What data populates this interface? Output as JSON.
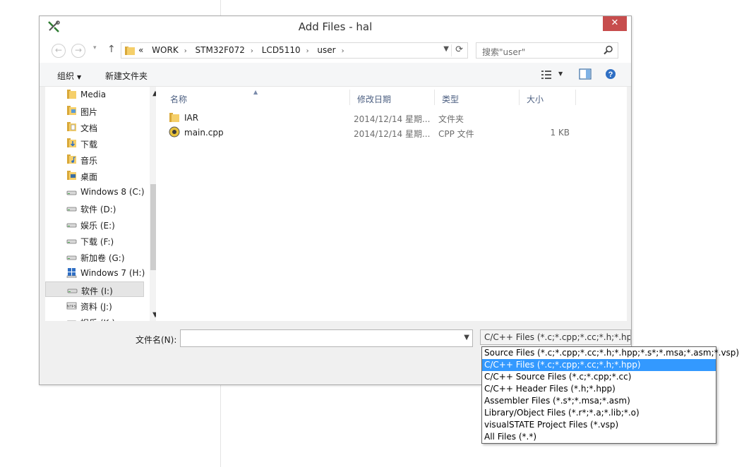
{
  "window": {
    "title": "Add Files - hal",
    "close_glyph": "✕"
  },
  "nav": {
    "back_glyph": "←",
    "forward_glyph": "→",
    "recent_glyph": "▾",
    "up_glyph": "↑",
    "breadcrumb_lead": "«",
    "breadcrumbs": [
      "WORK",
      "STM32F072",
      "LCD5110",
      "user"
    ],
    "crumb_sep": "›",
    "search_placeholder": "搜索\"user\""
  },
  "toolbar": {
    "organize": "组织",
    "new_folder": "新建文件夹"
  },
  "sidebar": {
    "items": [
      {
        "label": "Media",
        "icon": "folder-icon"
      },
      {
        "label": "图片",
        "icon": "pictures-icon"
      },
      {
        "label": "文档",
        "icon": "documents-icon"
      },
      {
        "label": "下载",
        "icon": "downloads-icon"
      },
      {
        "label": "音乐",
        "icon": "music-icon"
      },
      {
        "label": "桌面",
        "icon": "desktop-icon"
      },
      {
        "label": "Windows 8 (C:)",
        "icon": "drive-icon"
      },
      {
        "label": "软件 (D:)",
        "icon": "drive-icon"
      },
      {
        "label": "娱乐 (E:)",
        "icon": "drive-icon"
      },
      {
        "label": "下载 (F:)",
        "icon": "drive-icon"
      },
      {
        "label": "新加卷 (G:)",
        "icon": "drive-icon"
      },
      {
        "label": "Windows 7 (H:)",
        "icon": "windows-drive-icon"
      },
      {
        "label": "软件 (I:)",
        "icon": "drive-icon"
      },
      {
        "label": "资料 (J:)",
        "icon": "ntfs-drive-icon"
      },
      {
        "label": "娱乐 (K:)",
        "icon": "drive-icon"
      }
    ],
    "selected_index": 12
  },
  "files": {
    "columns": {
      "name": "名称",
      "date": "修改日期",
      "type": "类型",
      "size": "大小"
    },
    "rows": [
      {
        "name": "IAR",
        "date": "2014/12/14 星期...",
        "type": "文件夹",
        "size": "",
        "icon": "folder-icon"
      },
      {
        "name": "main.cpp",
        "date": "2014/12/14 星期...",
        "type": "CPP 文件",
        "size": "1 KB",
        "icon": "cpp-file-icon"
      }
    ]
  },
  "bottom": {
    "filename_label": "文件名(N):",
    "filename_value": "",
    "filter_selected": "C/C++ Files (*.c;*.cpp;*.cc;*.h;*.hpp)",
    "filter_options": [
      "Source Files (*.c;*.cpp;*.cc;*.h;*.hpp;*.s*;*.msa;*.asm;*.vsp)",
      "C/C++ Files (*.c;*.cpp;*.cc;*.h;*.hpp)",
      "C/C++ Source Files (*.c;*.cpp;*.cc)",
      "C/C++ Header Files (*.h;*.hpp)",
      "Assembler Files (*.s*;*.msa;*.asm)",
      "Library/Object Files (*.r*;*.a;*.lib;*.o)",
      "visualSTATE Project Files (*.vsp)",
      "All Files (*.*)"
    ],
    "filter_selected_index": 1
  },
  "colors": {
    "selection": "#3399ff",
    "close": "#c74d4d",
    "header_text": "#4d6082"
  }
}
